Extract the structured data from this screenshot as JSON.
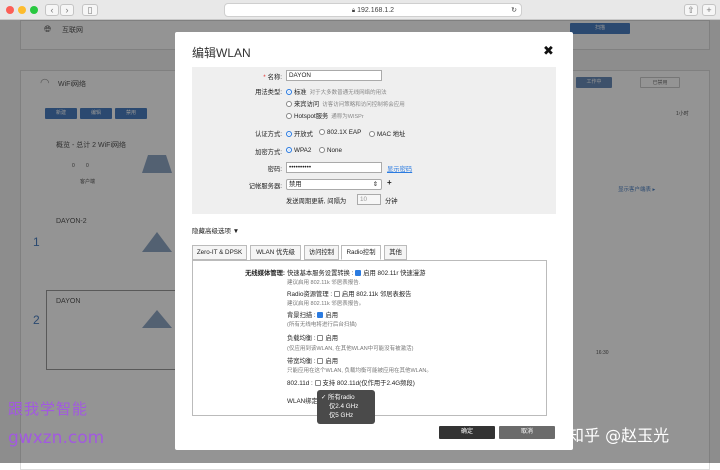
{
  "browser": {
    "url": "192.168.1.2"
  },
  "background": {
    "internet_label": "互联网",
    "wifi_label": "WiFi网络",
    "toolbar_buttons": [
      "新建",
      "编辑",
      "禁用"
    ],
    "overview_title": "概览 - 总计 2 WiFi网络",
    "client_label": "客户端",
    "ssid1": "DAYON-2",
    "ssid2": "DAYON",
    "row1_num": "1",
    "row2_num": "2",
    "zero": "0",
    "status_working": "工作中",
    "status_closed": "已禁用",
    "hour_select": "1小时",
    "show_clients": "显示客户端表 ▸",
    "time_label": "16:30",
    "top_button": "扫描"
  },
  "modal": {
    "title": "编辑WLAN",
    "name_label": "名称:",
    "name_value": "DAYON",
    "usage_label": "用法类型:",
    "usage_standard": "标准",
    "usage_standard_hint": "对于大多数普通无线网络的用法",
    "usage_guest": "来宾访问",
    "usage_guest_hint": "访客访问策略和访问控制将会应用",
    "usage_hotspot": "Hotspot服务",
    "usage_hotspot_hint": "通称为WISPr",
    "auth_label": "认证方式:",
    "auth_open": "开放式",
    "auth_8021x": "802.1X EAP",
    "auth_mac": "MAC 地址",
    "enc_label": "加密方式:",
    "enc_wpa2": "WPA2",
    "enc_none": "None",
    "pwd_label": "密码:",
    "pwd_value": "••••••••••",
    "pwd_show": "显示密码",
    "acct_label": "记帐服务器:",
    "acct_value": "禁用",
    "acct_add": "+",
    "interim_label": "发送周期更新, 间隔为",
    "interim_value": "10",
    "interim_unit": "分钟",
    "advanced_toggle": "隐藏高级选项 ▼",
    "tabs": [
      "Zero-IT & DPSK",
      "WLAN 优先级",
      "访问控制",
      "Radio控制",
      "其他"
    ],
    "radio": {
      "bss_label": "无线媒体管理:",
      "bss_value": "快速基本服务设置转换 :",
      "bss_check": "启用 802.11r 快速漫游",
      "bss_hint": "建议启用 802.11k 邻居表报告.",
      "rrm_value": "Radio资源管理 :",
      "rrm_check": "启用 802.11k 邻居表报告",
      "rrm_hint": "建议启用 802.11k 邻居表报告。",
      "bg_value": "背景扫描 :",
      "bg_check": "启用",
      "bg_hint": "(所有无线电将进行后台扫描)",
      "lb_value": "负载均衡 :",
      "lb_check": "启用",
      "lb_hint": "(仅应用到该WLAN, 在其他WLAN中可能没有被激活)",
      "band_value": "带宽均衡 :",
      "band_check": "启用",
      "band_hint": "只能应用在这个WLAN, 负载均衡可能被应用在其他WLAN。",
      "d_value": "802.11d :",
      "d_check": "支持 802.11d(仅作用于2.4G频段)",
      "bind_value": "WLAN绑定"
    },
    "dropdown_options": [
      "✓ 所有radio",
      "仅2.4 GHz",
      "仅5 GHz"
    ],
    "ok": "确定",
    "cancel": "取消"
  },
  "watermarks": {
    "line1": "跟我学智能",
    "line2": "gwxzn.com",
    "line3": "知乎 @赵玉光"
  },
  "colors": {
    "primary_blue": "#2b7be0",
    "ok_button": "#333333",
    "cancel_button": "#6b6b6b",
    "watermark": "#a259e0"
  }
}
